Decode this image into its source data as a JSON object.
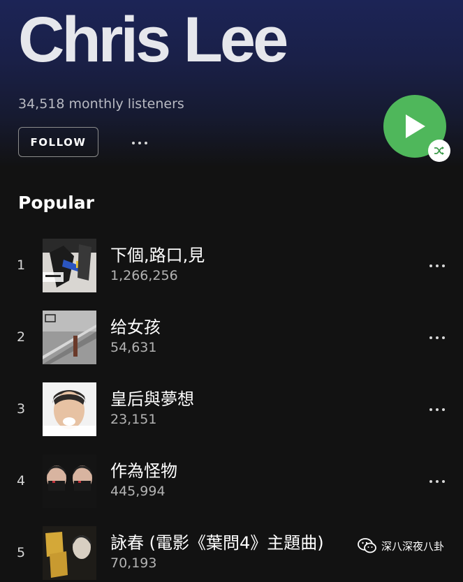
{
  "artist": {
    "name": "Chris Lee",
    "monthly_listeners": "34,518 monthly listeners"
  },
  "actions": {
    "follow_label": "FOLLOW",
    "more_icon": "more-horizontal-icon",
    "play_icon": "play-icon",
    "shuffle_icon": "shuffle-icon"
  },
  "popular": {
    "title": "Popular",
    "tracks": [
      {
        "rank": "1",
        "title": "下個,路口,見",
        "plays": "1,266,256"
      },
      {
        "rank": "2",
        "title": "给女孩",
        "plays": "54,631"
      },
      {
        "rank": "3",
        "title": "皇后與夢想",
        "plays": "23,151"
      },
      {
        "rank": "4",
        "title": "作為怪物",
        "plays": "445,994"
      },
      {
        "rank": "5",
        "title": "詠春 (電影《葉問4》主題曲)",
        "plays": "70,193"
      }
    ]
  },
  "watermark": {
    "icon": "wechat-icon",
    "text": "深八深夜八卦"
  },
  "colors": {
    "background": "#121212",
    "header_gradient_top": "#1c2456",
    "accent_green": "#4fb75b",
    "secondary_text": "#b3b3b3"
  }
}
